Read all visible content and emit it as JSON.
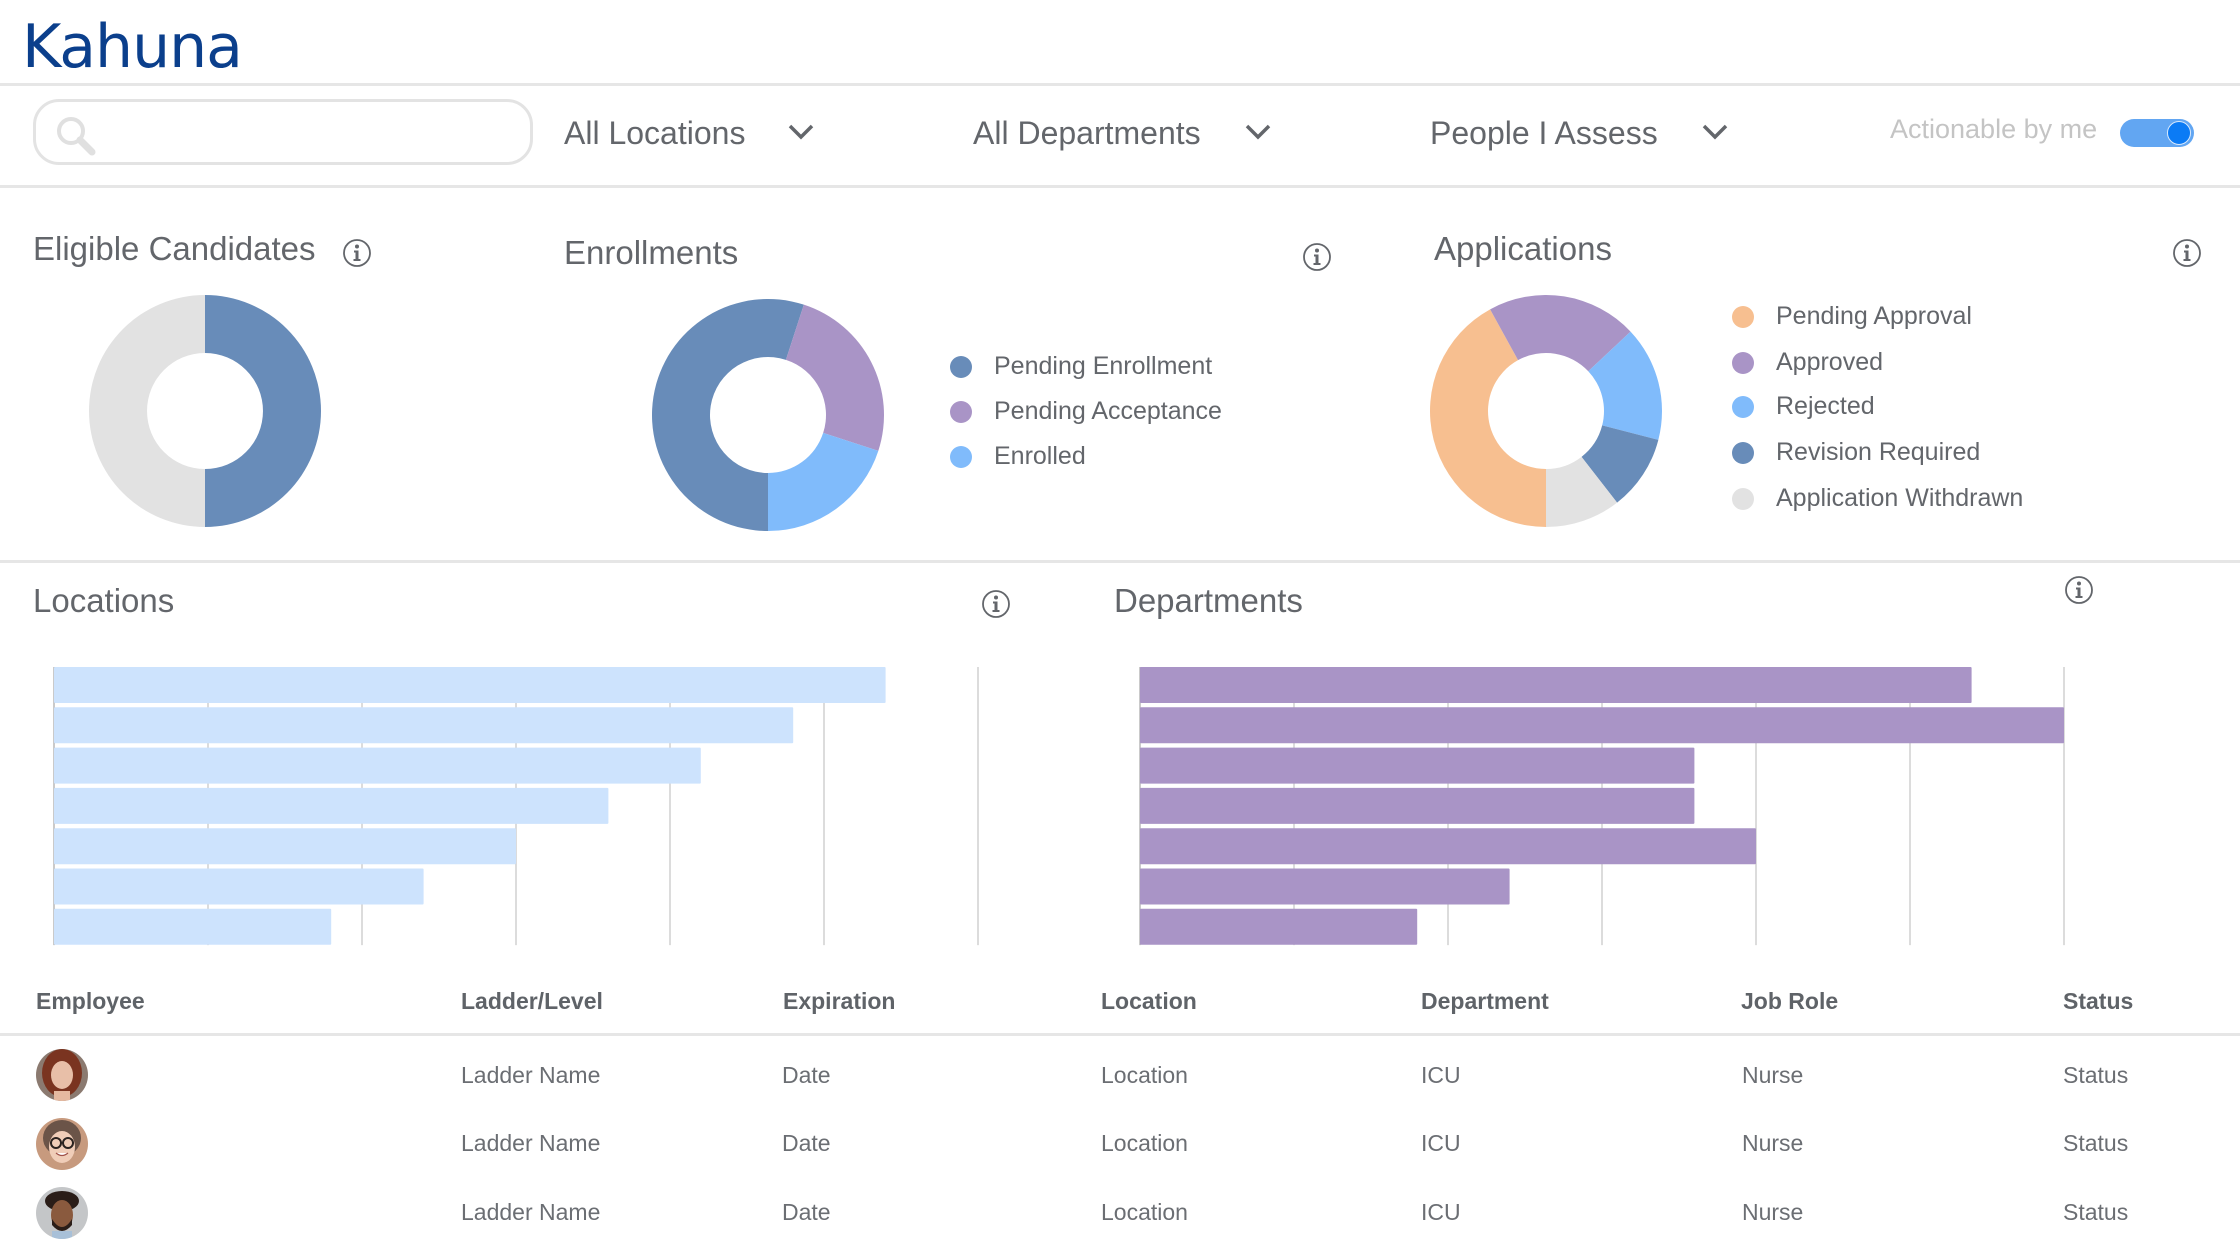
{
  "app": {
    "logo": "Kahuna",
    "brand_color": "#0b3f8c"
  },
  "filters": {
    "search": {
      "value": "",
      "placeholder": ""
    },
    "location": {
      "selected": "All Locations"
    },
    "department": {
      "selected": "All Departments"
    },
    "people": {
      "selected": "People I Assess"
    },
    "actionable_toggle": {
      "label": "Actionable by me",
      "on": true,
      "color": "#62a6f2"
    }
  },
  "cards": {
    "eligible": {
      "title": "Eligible Candidates"
    },
    "enrollments": {
      "title": "Enrollments",
      "legend": [
        {
          "label": "Pending Enrollment",
          "color": "#688cb9"
        },
        {
          "label": "Pending Acceptance",
          "color": "#a994c6"
        },
        {
          "label": "Enrolled",
          "color": "#80bbfb"
        }
      ]
    },
    "applications": {
      "title": "Applications",
      "legend": [
        {
          "label": "Pending Approval",
          "color": "#f7bf90"
        },
        {
          "label": "Approved",
          "color": "#a994c6"
        },
        {
          "label": "Rejected",
          "color": "#80bbfb"
        },
        {
          "label": "Revision Required",
          "color": "#688cb9"
        },
        {
          "label": "Application Withdrawn",
          "color": "#e2e2e2"
        }
      ]
    },
    "locations": {
      "title": "Locations"
    },
    "departments": {
      "title": "Departments"
    }
  },
  "chart_data": [
    {
      "id": "eligible",
      "type": "pie",
      "title": "Eligible Candidates",
      "donut": true,
      "start": "top",
      "slices": [
        {
          "label": "Eligible",
          "value": 50,
          "color": "#688cb9"
        },
        {
          "label": "Other",
          "value": 50,
          "color": "#e2e2e2"
        }
      ]
    },
    {
      "id": "enrollments",
      "type": "pie",
      "title": "Enrollments",
      "donut": true,
      "start": "bottom",
      "slices": [
        {
          "label": "Pending Enrollment",
          "value": 55,
          "color": "#688cb9"
        },
        {
          "label": "Pending Acceptance",
          "value": 25,
          "color": "#a994c6"
        },
        {
          "label": "Enrolled",
          "value": 20,
          "color": "#80bbfb"
        }
      ]
    },
    {
      "id": "applications",
      "type": "pie",
      "title": "Applications",
      "donut": true,
      "start": "bottom",
      "slices": [
        {
          "label": "Pending Approval",
          "value": 42,
          "color": "#f7bf90"
        },
        {
          "label": "Approved",
          "value": 21,
          "color": "#a994c6"
        },
        {
          "label": "Rejected",
          "value": 16,
          "color": "#80bbfb"
        },
        {
          "label": "Revision Required",
          "value": 10.5,
          "color": "#688cb9"
        },
        {
          "label": "Application Withdrawn",
          "value": 10.5,
          "color": "#e2e2e2"
        }
      ]
    },
    {
      "id": "locations",
      "type": "bar",
      "orientation": "horizontal",
      "title": "Locations",
      "categories": [
        "",
        "",
        "",
        "",
        "",
        "",
        ""
      ],
      "values": [
        5.4,
        4.8,
        4.2,
        3.6,
        3.0,
        2.4,
        1.8
      ],
      "xlim": [
        0,
        6
      ],
      "grid": true,
      "gridlines": 6,
      "color": "#cde3fd",
      "xlabel": "",
      "ylabel": ""
    },
    {
      "id": "departments",
      "type": "bar",
      "orientation": "horizontal",
      "title": "Departments",
      "categories": [
        "",
        "",
        "",
        "",
        "",
        "",
        ""
      ],
      "values": [
        5.4,
        6.0,
        3.6,
        3.6,
        4.0,
        2.4,
        1.8
      ],
      "xlim": [
        0,
        6
      ],
      "grid": true,
      "gridlines": 6,
      "color": "#a994c6",
      "xlabel": "",
      "ylabel": ""
    }
  ],
  "table": {
    "columns": [
      "Employee",
      "Ladder/Level",
      "Expiration",
      "Location",
      "Department",
      "Job Role",
      "Status"
    ],
    "rows": [
      {
        "avatar": "woman-red-hair",
        "ladder": "Ladder Name",
        "expiration": "Date",
        "location": "Location",
        "department": "ICU",
        "job_role": "Nurse",
        "status": "Status"
      },
      {
        "avatar": "woman-glasses",
        "ladder": "Ladder Name",
        "expiration": "Date",
        "location": "Location",
        "department": "ICU",
        "job_role": "Nurse",
        "status": "Status"
      },
      {
        "avatar": "man-beard",
        "ladder": "Ladder Name",
        "expiration": "Date",
        "location": "Location",
        "department": "ICU",
        "job_role": "Nurse",
        "status": "Status"
      }
    ]
  }
}
